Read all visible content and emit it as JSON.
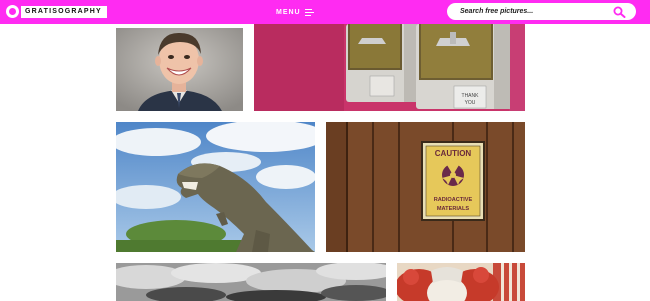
{
  "header": {
    "logo_text": "GRATISOGRAPHY",
    "menu_label": "MENU",
    "search_placeholder": "Search free pictures..."
  },
  "photos": [
    {
      "id": "photo-smiling-man",
      "subject": "smiling man in suit"
    },
    {
      "id": "photo-gumball-machines",
      "subject": "coin machines on pink wall",
      "label": "THANK YOU"
    },
    {
      "id": "photo-dinosaur",
      "subject": "dinosaur statue against sky"
    },
    {
      "id": "photo-caution-sign",
      "subject": "radioactive sign on wooden wall",
      "sign_title": "CAUTION",
      "sign_text": "RADIOACTIVE MATERIALS"
    },
    {
      "id": "photo-clouds",
      "subject": "black and white clouds"
    },
    {
      "id": "photo-clown",
      "subject": "clown with red hair"
    }
  ],
  "colors": {
    "brand": "#ff2bf2"
  }
}
